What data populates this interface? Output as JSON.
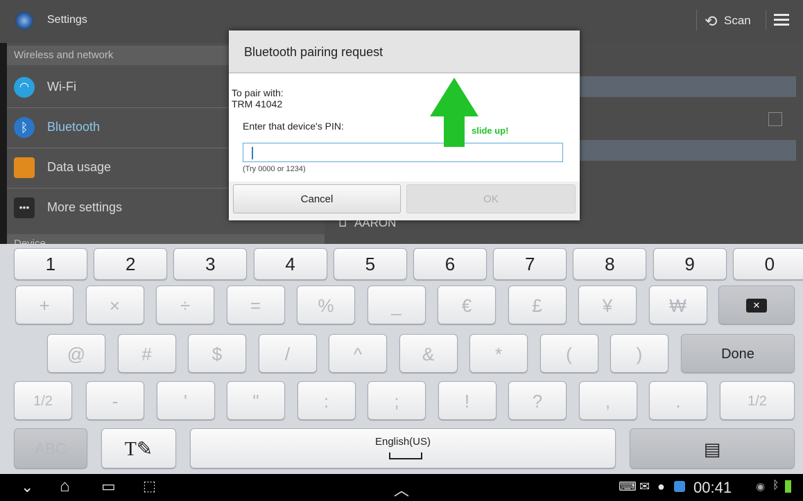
{
  "action_bar": {
    "title": "Settings",
    "scan_label": "Scan"
  },
  "sidebar": {
    "section_wireless": "Wireless and network",
    "items": [
      "Wi-Fi",
      "Bluetooth",
      "Data usage",
      "More settings"
    ],
    "section_device": "Device"
  },
  "detail": {
    "device_name": "AARON"
  },
  "dialog": {
    "title": "Bluetooth pairing request",
    "pair_with_label": "To pair with:",
    "device": "TRM 41042",
    "pin_prompt": "Enter that device's PIN:",
    "pin_value": "",
    "hint": "(Try 0000 or 1234)",
    "cancel": "Cancel",
    "ok": "OK"
  },
  "annotation": {
    "text": "slide up!",
    "color": "#22c32a"
  },
  "keyboard": {
    "numbers": [
      "1",
      "2",
      "3",
      "4",
      "5",
      "6",
      "7",
      "8",
      "9",
      "0"
    ],
    "row2": [
      "+",
      "×",
      "÷",
      "=",
      "%",
      "_",
      "€",
      "£",
      "¥",
      "₩"
    ],
    "row3": [
      "@",
      "#",
      "$",
      "/",
      "^",
      "&",
      "*",
      "(",
      ")"
    ],
    "done": "Done",
    "row4_left": "1/2",
    "row4": [
      "-",
      "'",
      "\"",
      ":",
      ";",
      "!",
      "?",
      ",",
      "."
    ],
    "row4_right": "1/2",
    "abc": "ABC",
    "language": "English(US)"
  },
  "status": {
    "time": "00:41"
  },
  "colors": {
    "accent": "#35b1e6",
    "dialog_field": "#5aa9d6"
  }
}
